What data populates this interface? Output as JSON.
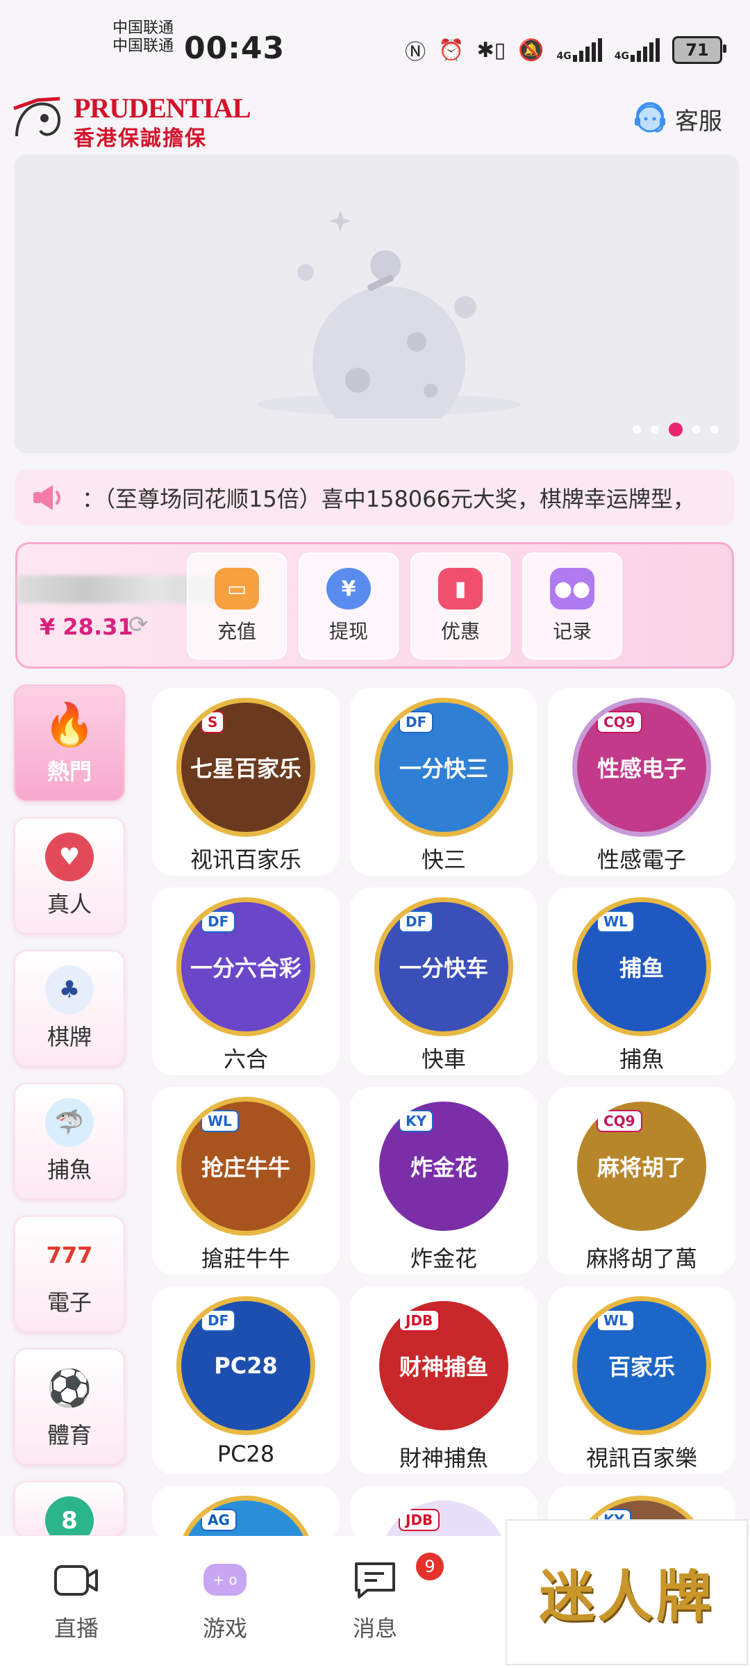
{
  "status_bar": {
    "carrier_1": "中国联通",
    "carrier_2": "中国联通",
    "time": "00:43",
    "network_1": "4G",
    "network_2": "4G",
    "battery": "71"
  },
  "header": {
    "logo_text": "PRUDENTIAL",
    "logo_subtitle": "香港保誠擔保",
    "customer_service_label": "客服"
  },
  "banner": {
    "active_slide_index": 2,
    "slide_count": 5
  },
  "marquee": {
    "text": "：（至尊场同花顺15倍）喜中158066元大奖，棋牌幸运牌型，"
  },
  "account": {
    "balance": "¥ 28.31",
    "actions": [
      {
        "label": "充值",
        "icon": "wallet-icon",
        "color": "#f6a040"
      },
      {
        "label": "提现",
        "icon": "yen-coin-icon",
        "color": "#5a8cf0"
      },
      {
        "label": "优惠",
        "icon": "ticket-icon",
        "color": "#f0506e"
      },
      {
        "label": "记录",
        "icon": "gamepad-icon",
        "color": "#b07af0"
      }
    ]
  },
  "categories": [
    {
      "label": "熱門",
      "icon": "flame-icon",
      "active": true
    },
    {
      "label": "真人",
      "icon": "chip-icon"
    },
    {
      "label": "棋牌",
      "icon": "cards-icon"
    },
    {
      "label": "捕魚",
      "icon": "shark-icon"
    },
    {
      "label": "電子",
      "icon": "slot-777-icon"
    },
    {
      "label": "體育",
      "icon": "soccer-ball-icon"
    }
  ],
  "games": [
    {
      "label": "视讯百家乐",
      "art_text": "七星百家乐",
      "tag": "S",
      "color": "#6b3a1e"
    },
    {
      "label": "快三",
      "art_text": "一分快三",
      "tag": "DF",
      "color": "#2f7fd4"
    },
    {
      "label": "性感電子",
      "art_text": "性感电子",
      "tag": "CQ9",
      "color": "#c23a8a"
    },
    {
      "label": "六合",
      "art_text": "一分六合彩",
      "tag": "DF",
      "color": "#6a46c8"
    },
    {
      "label": "快車",
      "art_text": "一分快车",
      "tag": "DF",
      "color": "#3a4fb8"
    },
    {
      "label": "捕魚",
      "art_text": "捕鱼",
      "tag": "WL",
      "color": "#1e58c0"
    },
    {
      "label": "搶莊牛牛",
      "art_text": "抢庄牛牛",
      "tag": "WL",
      "color": "#a8541e"
    },
    {
      "label": "炸金花",
      "art_text": "炸金花",
      "tag": "KY",
      "color": "#7a2ea8"
    },
    {
      "label": "麻將胡了萬",
      "art_text": "麻将胡了",
      "tag": "CQ9",
      "color": "#b8862a"
    },
    {
      "label": "PC28",
      "art_text": "PC28",
      "tag": "DF",
      "color": "#1d4fb0"
    },
    {
      "label": "財神捕魚",
      "art_text": "财神捕鱼",
      "tag": "JDB",
      "color": "#c8282a"
    },
    {
      "label": "視訊百家樂",
      "art_text": "百家乐",
      "tag": "WL",
      "color": "#1c66c8"
    }
  ],
  "peek_games": [
    {
      "tag": "AG"
    },
    {
      "tag": "JDB"
    },
    {
      "tag": "KY"
    }
  ],
  "bottom_nav": [
    {
      "label": "直播",
      "icon": "video-camera-icon"
    },
    {
      "label": "游戏",
      "icon": "gamepad-icon",
      "active": true
    },
    {
      "label": "消息",
      "icon": "message-icon",
      "badge": "9"
    }
  ],
  "watermark": {
    "text": "迷人牌"
  }
}
